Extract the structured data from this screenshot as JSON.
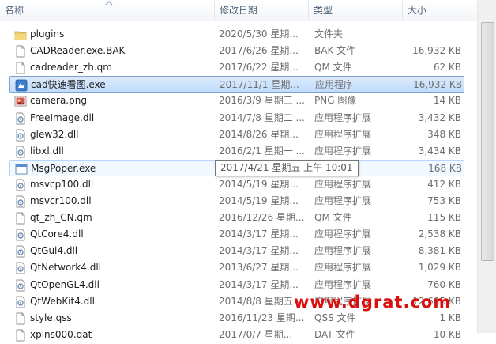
{
  "header": {
    "col_name": "名称",
    "col_date": "修改日期",
    "col_type": "类型",
    "col_size": "大小"
  },
  "files": [
    {
      "name": "plugins",
      "date": "2020/5/30 星期...",
      "type": "文件夹",
      "size": "",
      "icon": "folder-icon",
      "state": "normal"
    },
    {
      "name": "CADReader.exe.BAK",
      "date": "2017/6/26 星期...",
      "type": "BAK 文件",
      "size": "16,932 KB",
      "icon": "document-icon",
      "state": "normal"
    },
    {
      "name": "cadreader_zh.qm",
      "date": "2017/6/22 星期...",
      "type": "QM 文件",
      "size": "62 KB",
      "icon": "document-icon",
      "state": "normal"
    },
    {
      "name": "cad快速看图.exe",
      "date": "2017/11/1 星期...",
      "type": "应用程序",
      "size": "16,932 KB",
      "icon": "app-icon",
      "state": "selected"
    },
    {
      "name": "camera.png",
      "date": "2016/3/9 星期三 ...",
      "type": "PNG 图像",
      "size": "14 KB",
      "icon": "image-icon",
      "state": "normal"
    },
    {
      "name": "FreeImage.dll",
      "date": "2014/7/8 星期二 ...",
      "type": "应用程序扩展",
      "size": "3,432 KB",
      "icon": "dll-icon",
      "state": "normal"
    },
    {
      "name": "glew32.dll",
      "date": "2014/8/26 星期...",
      "type": "应用程序扩展",
      "size": "348 KB",
      "icon": "dll-icon",
      "state": "normal"
    },
    {
      "name": "libxl.dll",
      "date": "2016/2/1 星期一 ...",
      "type": "应用程序扩展",
      "size": "3,434 KB",
      "icon": "dll-icon",
      "state": "normal"
    },
    {
      "name": "MsgPoper.exe",
      "date": "",
      "type": "",
      "size": "168 KB",
      "icon": "window-icon",
      "state": "hover"
    },
    {
      "name": "msvcp100.dll",
      "date": "2014/5/19 星期...",
      "type": "应用程序扩展",
      "size": "412 KB",
      "icon": "dll-icon",
      "state": "normal"
    },
    {
      "name": "msvcr100.dll",
      "date": "2014/5/19 星期...",
      "type": "应用程序扩展",
      "size": "753 KB",
      "icon": "dll-icon",
      "state": "normal"
    },
    {
      "name": "qt_zh_CN.qm",
      "date": "2016/12/26 星期...",
      "type": "QM 文件",
      "size": "115 KB",
      "icon": "document-icon",
      "state": "normal"
    },
    {
      "name": "QtCore4.dll",
      "date": "2014/3/17 星期...",
      "type": "应用程序扩展",
      "size": "2,538 KB",
      "icon": "dll-icon",
      "state": "normal"
    },
    {
      "name": "QtGui4.dll",
      "date": "2014/3/17 星期...",
      "type": "应用程序扩展",
      "size": "8,381 KB",
      "icon": "dll-icon",
      "state": "normal"
    },
    {
      "name": "QtNetwork4.dll",
      "date": "2013/6/27 星期...",
      "type": "应用程序扩展",
      "size": "1,029 KB",
      "icon": "dll-icon",
      "state": "normal"
    },
    {
      "name": "QtOpenGL4.dll",
      "date": "2014/3/17 星期...",
      "type": "应用程序扩展",
      "size": "760 KB",
      "icon": "dll-icon",
      "state": "normal"
    },
    {
      "name": "QtWebKit4.dll",
      "date": "2014/8/8 星期五 ...",
      "type": "应用程序扩展",
      "size": "12,605 KB",
      "icon": "dll-icon",
      "state": "normal"
    },
    {
      "name": "style.qss",
      "date": "2016/11/23 星期...",
      "type": "QSS 文件",
      "size": "1 KB",
      "icon": "document-icon",
      "state": "normal"
    },
    {
      "name": "xpins000.dat",
      "date": "2017/0/7 星期...",
      "type": "DAT 文件",
      "size": "10 KB",
      "icon": "document-icon",
      "state": "normal"
    }
  ],
  "tooltip": {
    "text": "2017/4/21 星期五 上午 10:01"
  },
  "watermark": {
    "text": "www.dgrat.com"
  },
  "colors": {
    "header_text": "#4c607a",
    "selected_border": "#7da2ce",
    "selected_fill": "#cce1fc",
    "folder": "#e8c15a",
    "watermark": "#d81010"
  }
}
